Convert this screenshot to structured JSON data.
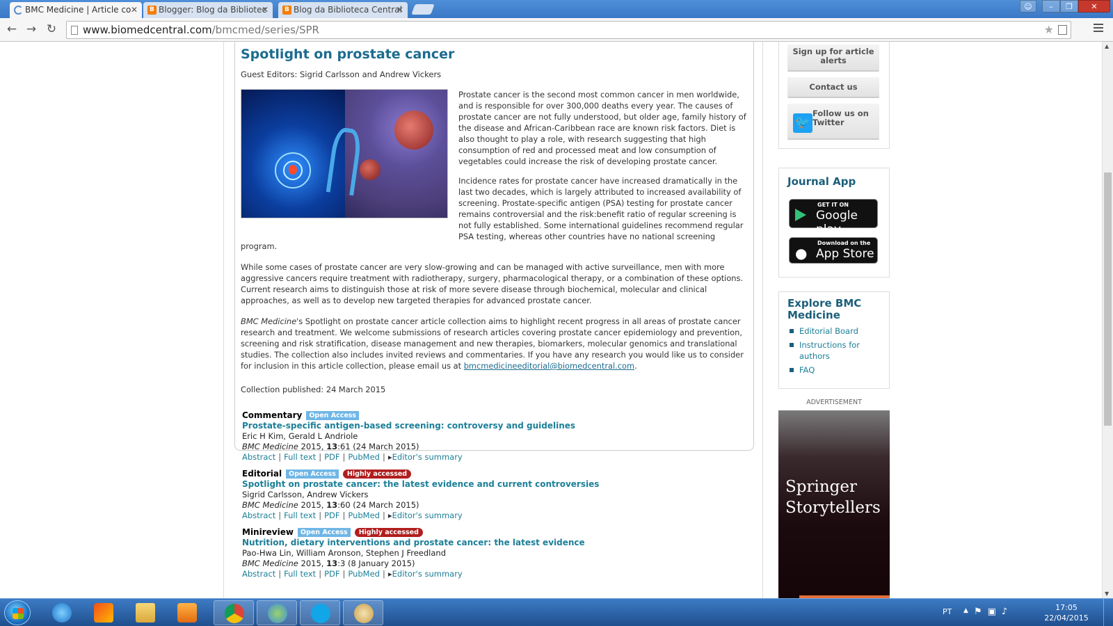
{
  "browser": {
    "tabs": [
      {
        "label": "BMC Medicine | Article co",
        "active": true
      },
      {
        "label": "Blogger: Blog da Bibliotec",
        "active": false
      },
      {
        "label": "Blog da Biblioteca Central",
        "active": false
      }
    ],
    "url_host": "www.biomedcentral.com",
    "url_path": "/bmcmed/series/SPR"
  },
  "spotlight": {
    "title": "Spotlight on prostate cancer",
    "guest_editors": "Guest Editors: Sigrid Carlsson and Andrew Vickers",
    "para1": "Prostate cancer is the second most common cancer in men worldwide, and is responsible for over 300,000 deaths every year. The causes of prostate cancer are not fully understood, but older age, family history of the disease and African-Caribbean race are known risk factors. Diet is also thought to play a role, with research suggesting that high consumption of red and processed meat and low consumption of vegetables could increase the risk of developing prostate cancer.",
    "para2": "Incidence rates for prostate cancer have increased dramatically in the last two decades, which is largely attributed to increased availability of screening. Prostate-specific antigen (PSA) testing for prostate cancer remains controversial and the risk:benefit ratio of regular screening is not fully established. Some international guidelines recommend regular PSA testing, whereas other countries have no national screening",
    "para2_tail": "program.",
    "para3": "While some cases of prostate cancer are very slow-growing and can be managed with active surveillance, men with more aggressive cancers require treatment with radiotherapy, surgery, pharmacological therapy, or a combination of these options. Current research aims to distinguish those at risk of more severe disease through biochemical, molecular and clinical approaches, as well as to develop new targeted therapies for advanced prostate cancer.",
    "para4_journal": "BMC Medicine",
    "para4_rest": "'s Spotlight on prostate cancer article collection aims to highlight recent progress in all areas of prostate cancer research and treatment. We welcome submissions of research articles covering prostate cancer epidemiology and prevention, screening and risk stratification, disease management and new therapies, biomarkers, molecular genomics and translational studies. The collection also includes invited reviews and commentaries. If you have any research you would like us to consider for inclusion in this article collection, please email us at ",
    "para4_email": "bmcmedicineeditorial@biomedcentral.com",
    "para4_end": ".",
    "published": "Collection published: 24 March 2015"
  },
  "articles": [
    {
      "type": "Commentary",
      "badges": [
        "Open Access"
      ],
      "title": "Prostate-specific antigen-based screening: controversy and guidelines",
      "authors": "Eric H Kim, Gerald L Andriole",
      "journal": "BMC Medicine",
      "cite_year": " 2015, ",
      "cite_vol": "13",
      "cite_rest": ":61 (24 March 2015)"
    },
    {
      "type": "Editorial",
      "badges": [
        "Open Access",
        "Highly accessed"
      ],
      "title": "Spotlight on prostate cancer: the latest evidence and current controversies",
      "authors": "Sigrid Carlsson, Andrew Vickers",
      "journal": "BMC Medicine",
      "cite_year": " 2015, ",
      "cite_vol": "13",
      "cite_rest": ":60 (24 March 2015)"
    },
    {
      "type": "Minireview",
      "badges": [
        "Open Access",
        "Highly accessed"
      ],
      "title": "Nutrition, dietary interventions and prostate cancer: the latest evidence",
      "authors": "Pao-Hwa Lin, William Aronson, Stephen J Freedland",
      "journal": "BMC Medicine",
      "cite_year": " 2015, ",
      "cite_vol": "13",
      "cite_rest": ":3 (8 January 2015)"
    }
  ],
  "article_links": {
    "abstract": "Abstract",
    "full_text": "Full text",
    "pdf": "PDF",
    "pubmed": "PubMed",
    "summary": "Editor's summary",
    "sep": "|"
  },
  "sidebar": {
    "signup": "Sign up for article alerts",
    "contact": "Contact us",
    "follow": "Follow us on Twitter",
    "app_heading": "Journal App",
    "google_small": "GET IT ON",
    "google_big": "Google play",
    "apple_small": "Download on the",
    "apple_big": "App Store",
    "explore_heading": "Explore BMC Medicine",
    "explore_items": [
      "Editorial Board",
      "Instructions for authors",
      "FAQ"
    ],
    "ad_label": "ADVERTISEMENT",
    "ad_text": "Springer Storytellers"
  },
  "taskbar": {
    "lang": "PT",
    "time": "17:05",
    "date": "22/04/2015"
  },
  "colors": {
    "link": "#1c7f98",
    "heading": "#1c6b8f",
    "open_access": "#6fb6e6",
    "highly_accessed": "#b11e1e"
  }
}
